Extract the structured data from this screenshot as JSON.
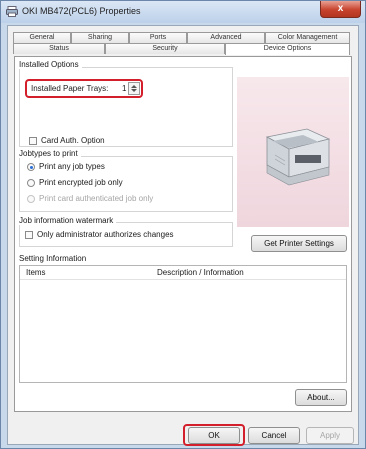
{
  "window": {
    "title": "OKI MB472(PCL6) Properties",
    "close_label": "x"
  },
  "tabs_row1": [
    "General",
    "Sharing",
    "Ports",
    "Advanced",
    "Color Management"
  ],
  "tabs_row2": [
    "Status",
    "Security",
    "Device Options"
  ],
  "installed_options": {
    "group_label": "Installed Options",
    "paper_trays_label": "Installed Paper Trays:",
    "paper_trays_value": "1",
    "card_auth_label": "Card Auth. Option"
  },
  "jobtypes": {
    "group_label": "Jobtypes to print",
    "opt1": "Print any job types",
    "opt2": "Print encrypted job only",
    "opt3": "Print card authenticated job only"
  },
  "watermark": {
    "group_label": "Job information watermark",
    "only_admin_label": "Only administrator authorizes changes"
  },
  "get_printer_settings_label": "Get Printer Settings",
  "setting_information": {
    "label": "Setting Information",
    "col_items": "Items",
    "col_desc": "Description / Information"
  },
  "about_label": "About...",
  "footer": {
    "ok": "OK",
    "cancel": "Cancel",
    "apply": "Apply"
  },
  "colors": {
    "highlight": "#d21f2b",
    "printer_backdrop": "#f3dde3"
  }
}
